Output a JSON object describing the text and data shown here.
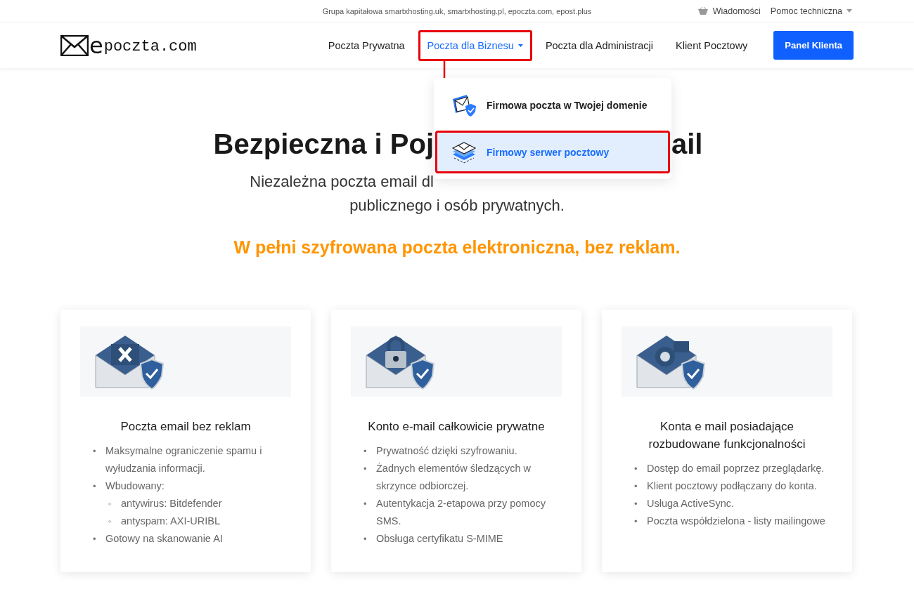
{
  "top_bar": {
    "group_text": "Grupa kapitałowa smartxhosting.uk, smartxhosting.pl, epoczta.com, epost.plus",
    "links": [
      {
        "label": "Wiadomości",
        "kind": "basket"
      },
      {
        "label": "Pomoc techniczna",
        "kind": "dropdown"
      }
    ]
  },
  "header": {
    "logo": "poczta.com",
    "logo_initial": "e",
    "nav": [
      {
        "label": "Poczta Prywatna",
        "selected": false,
        "has_menu": false,
        "annotated": false
      },
      {
        "label": "Poczta dla Biznesu",
        "selected": true,
        "has_menu": true,
        "annotated": true
      },
      {
        "label": "Poczta dla Administracji",
        "selected": false,
        "has_menu": false,
        "annotated": false
      },
      {
        "label": "Klient Pocztowy",
        "selected": false,
        "has_menu": false,
        "annotated": false
      }
    ],
    "cta": "Panel Klienta"
  },
  "dropdown": {
    "items": [
      {
        "label": "Firmowa poczta w Twojej domenie",
        "kind": "shield",
        "selected": false,
        "annotated": false
      },
      {
        "label": "Firmowy serwer pocztowy",
        "kind": "layers",
        "selected": true,
        "annotated": true
      }
    ]
  },
  "hero": {
    "heading_left": "Bezpieczna i Poj",
    "heading_right": "ail",
    "subtitle_line_1": "Niezależna poczta email dl",
    "subtitle_line_2": "publicznego i osób prywatnych.",
    "tagline": "W pełni szyfrowana poczta elektroniczna, bez reklam."
  },
  "cards": [
    {
      "title": "Poczta email bez reklam",
      "kind": "cross",
      "items": [
        {
          "marker": "•",
          "text": "Maksymalne ograniczenie spamu i wyłudzania informacji."
        },
        {
          "marker": "•",
          "text": "Wbudowany:",
          "children": [
            {
              "marker": "◦",
              "text": "antywirus: Bitdefender"
            },
            {
              "marker": "◦",
              "text": "antyspam: AXI-URIBL"
            }
          ]
        },
        {
          "marker": "•",
          "text": "Gotowy na skanowanie AI"
        }
      ]
    },
    {
      "title": "Konto e-mail całkowicie prywatne",
      "kind": "lock",
      "items": [
        {
          "marker": "•",
          "text": "Prywatność dzięki szyfrowaniu."
        },
        {
          "marker": "•",
          "text": "Żadnych elementów śledzących w skrzynce odbiorczej."
        },
        {
          "marker": "•",
          "text": "Autentykacja 2-etapowa przy pomocy SMS."
        },
        {
          "marker": "•",
          "text": "Obsługa certyfikatu S-MIME"
        }
      ]
    },
    {
      "title": "Konta e mail posiadające rozbudowane funkcjonalności",
      "kind": "gear",
      "items": [
        {
          "marker": "•",
          "text": "Dostęp do email poprzez przeglądarkę."
        },
        {
          "marker": "•",
          "text": "Klient pocztowy podłączany do konta."
        },
        {
          "marker": "•",
          "text": "Usługa ActiveSync."
        },
        {
          "marker": "•",
          "text": "Poczta współdzielona - listy mailingowe"
        }
      ]
    }
  ]
}
